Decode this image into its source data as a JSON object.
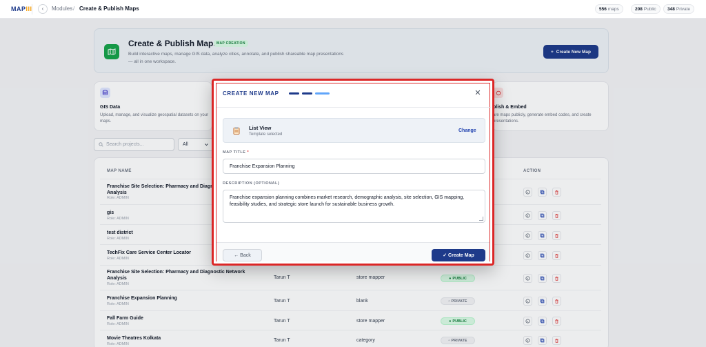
{
  "topbar": {
    "logo_main": "MAP",
    "logo_hl": "III",
    "back_glyph": "‹",
    "breadcrumb": {
      "modules": "Modules",
      "separator": "/",
      "current": "Create & Publish Maps"
    },
    "stats": [
      {
        "value": "556",
        "label": "maps"
      },
      {
        "value": "208",
        "label": "Public"
      },
      {
        "value": "348",
        "label": "Private"
      }
    ]
  },
  "hero": {
    "title": "Create & Publish Maps",
    "badge": "MAP CREATION",
    "description": "Build interactive maps, manage GIS data, analyze cities, annotate, and publish shareable map presentations — all in one workspace.",
    "button_label": "Create New Map",
    "button_icon": "+"
  },
  "cards": [
    {
      "title": "GIS Data",
      "description": "Upload, manage, and visualize geospatial datasets on your maps."
    },
    {
      "title": "blish & Embed",
      "description": "are maps publicly, generate embed codes, and create presentations."
    }
  ],
  "toolbar": {
    "search_placeholder": "Search projects...",
    "filter_value": "All"
  },
  "table": {
    "headers": {
      "name": "MAP NAME",
      "action": "ACTION"
    },
    "rows": [
      {
        "name": "Franchise Site Selection: Pharmacy and Diagnostic Network Analysis",
        "role": "Role: ADMIN",
        "owner": "",
        "template": "",
        "visibility": ""
      },
      {
        "name": "gis",
        "role": "Role: ADMIN",
        "owner": "",
        "template": "",
        "visibility": ""
      },
      {
        "name": "test district",
        "role": "Role: ADMIN",
        "owner": "",
        "template": "",
        "visibility": ""
      },
      {
        "name": "TechFix Care Service Center Locator",
        "role": "Role: ADMIN",
        "owner": "",
        "template": "",
        "visibility": ""
      },
      {
        "name": "Franchise Site Selection: Pharmacy and Diagnostic Network Analysis",
        "role": "Role: ADMIN",
        "owner": "Tarun T",
        "template": "store mapper",
        "visibility": "PUBLIC"
      },
      {
        "name": "Franchise Expansion Planning",
        "role": "Role: ADMIN",
        "owner": "Tarun T",
        "template": "blank",
        "visibility": "PRIVATE"
      },
      {
        "name": "Fall Farm Guide",
        "role": "Role: ADMIN",
        "owner": "Tarun T",
        "template": "store mapper",
        "visibility": "PUBLIC"
      },
      {
        "name": "Movie Theatres Kolkata",
        "role": "Role: ADMIN",
        "owner": "Tarun T",
        "template": "category",
        "visibility": "PRIVATE"
      }
    ]
  },
  "modal": {
    "title": "CREATE NEW MAP",
    "close_glyph": "✕",
    "template": {
      "name": "List View",
      "status": "Template selected",
      "change_label": "Change"
    },
    "map_title_label": "MAP TITLE",
    "required_mark": "*",
    "map_title_value": "Franchise Expansion Planning",
    "description_label": "DESCRIPTION (OPTIONAL)",
    "description_value": "Franchise expansion planning combines market research, demographic analysis, site selection, GIS mapping, feasibility studies, and strategic store launch for sustainable business growth.",
    "back_label": "← Back",
    "create_label": "✓ Create Map"
  },
  "colors": {
    "primary": "#1e3a8a",
    "accent_red": "#dc2626",
    "public_green": "#15803d"
  }
}
